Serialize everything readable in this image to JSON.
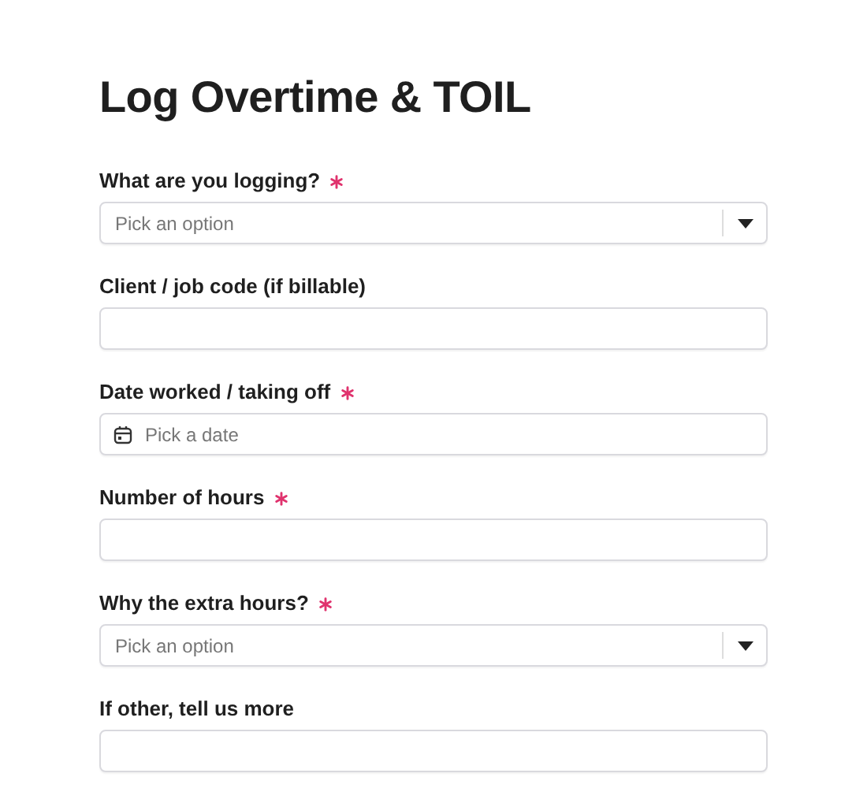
{
  "title": "Log Overtime & TOIL",
  "fields": [
    {
      "label": "What are you logging?",
      "required": true,
      "kind": "select",
      "placeholder": "Pick an option"
    },
    {
      "label": "Client / job code (if billable)",
      "required": false,
      "kind": "text"
    },
    {
      "label": "Date worked / taking off",
      "required": true,
      "kind": "date",
      "placeholder": "Pick a date"
    },
    {
      "label": "Number of hours",
      "required": true,
      "kind": "text"
    },
    {
      "label": "Why the extra hours?",
      "required": true,
      "kind": "select",
      "placeholder": "Pick an option"
    },
    {
      "label": "If other, tell us more",
      "required": false,
      "kind": "text"
    }
  ]
}
